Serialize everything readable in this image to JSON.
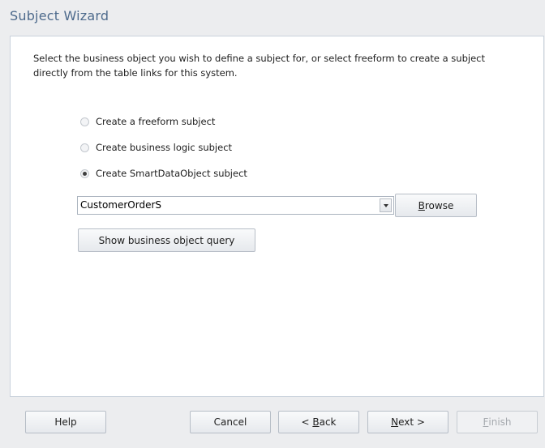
{
  "window": {
    "title": "Subject Wizard"
  },
  "instruction": "Select the business object you wish to define a subject for, or select freeform to create a subject directly from the table links for this system.",
  "options": [
    {
      "label": "Create a freeform subject",
      "selected": false
    },
    {
      "label": "Create business logic subject",
      "selected": false
    },
    {
      "label": "Create SmartDataObject subject",
      "selected": true
    }
  ],
  "combo": {
    "value": "CustomerOrderS"
  },
  "buttons": {
    "browse": {
      "mnemonic": "B",
      "rest": "rowse"
    },
    "show_query": "Show business object query",
    "help": "Help",
    "cancel": "Cancel",
    "back": {
      "prefix": "< ",
      "mnemonic": "B",
      "rest": "ack"
    },
    "next": {
      "mnemonic": "N",
      "rest": "ext >"
    },
    "finish": {
      "mnemonic": "F",
      "rest": "inish"
    }
  }
}
